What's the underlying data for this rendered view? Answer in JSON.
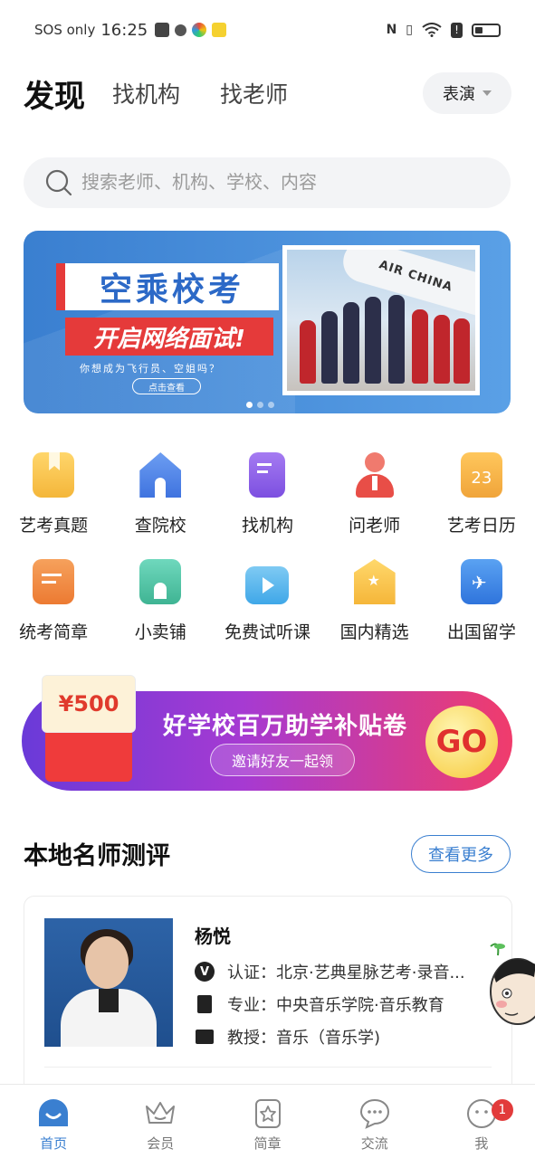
{
  "status_bar": {
    "carrier": "SOS only",
    "time": "16:25"
  },
  "header": {
    "tabs": [
      "发现",
      "找机构",
      "找老师"
    ],
    "active_tab": "发现",
    "category_select": "表演"
  },
  "search": {
    "placeholder": "搜索老师、机构、学校、内容"
  },
  "banner": {
    "title": "空乘校考",
    "subtitle": "开启网络面试!",
    "tagline": "你想成为飞行员、空姐吗？",
    "button": "点击查看",
    "photo_text": "AIR CHINA",
    "slide_count": 3,
    "active_slide": 0
  },
  "shortcuts": [
    {
      "label": "艺考真题",
      "icon": "bookmark-book-icon",
      "color": "#f7c448"
    },
    {
      "label": "查院校",
      "icon": "school-building-icon",
      "color": "#4f86e8"
    },
    {
      "label": "找机构",
      "icon": "institution-icon",
      "color": "#8a5ae6"
    },
    {
      "label": "问老师",
      "icon": "teacher-icon",
      "color": "#ec5a52"
    },
    {
      "label": "艺考日历",
      "icon": "calendar-icon",
      "color": "#f5b342",
      "calendar_day": "23"
    },
    {
      "label": "统考简章",
      "icon": "brochure-icon",
      "color": "#f08a3c"
    },
    {
      "label": "小卖铺",
      "icon": "shop-icon",
      "color": "#4dc3a6"
    },
    {
      "label": "免费试听课",
      "icon": "tv-play-icon",
      "color": "#4fb5ea"
    },
    {
      "label": "国内精选",
      "icon": "star-badge-icon",
      "color": "#f7c448"
    },
    {
      "label": "出国留学",
      "icon": "airplane-book-icon",
      "color": "#3f86e8"
    }
  ],
  "promo": {
    "amount": "¥500",
    "heading": "好学校百万助学补贴卷",
    "invite_button": "邀请好友一起领",
    "go_button": "GO"
  },
  "section": {
    "title": "本地名师测评",
    "more_button": "查看更多"
  },
  "teacher": {
    "name": "杨悦",
    "certification": "认证：北京·艺典星脉艺考·录音...",
    "major": "专业：中央音乐学院·音乐教育",
    "teaching": "教授：音乐（音乐学)"
  },
  "bottom_nav": [
    {
      "label": "首页",
      "icon": "home-icon",
      "active": true
    },
    {
      "label": "会员",
      "icon": "crown-icon",
      "active": false
    },
    {
      "label": "简章",
      "icon": "star-document-icon",
      "active": false
    },
    {
      "label": "交流",
      "icon": "chat-bubble-icon",
      "active": false
    },
    {
      "label": "我",
      "icon": "profile-face-icon",
      "active": false,
      "badge": "1"
    }
  ],
  "colors": {
    "accent": "#3a7fd0",
    "badge": "#e23b3b"
  }
}
